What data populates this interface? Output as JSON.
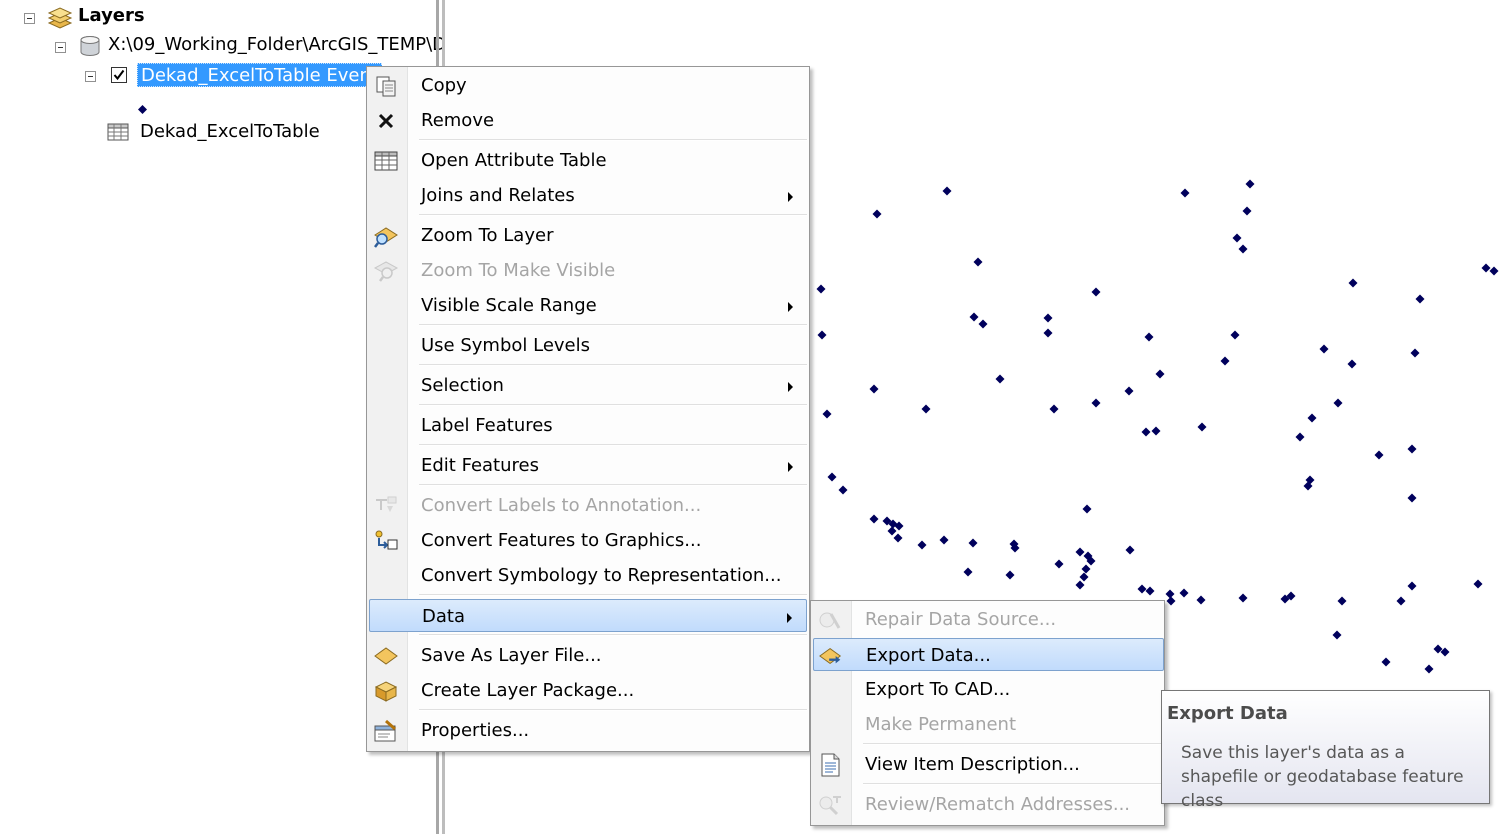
{
  "toc": {
    "root_label": "Layers",
    "data_source": "X:\\09_Working_Folder\\ArcGIS_TEMP\\D",
    "selected_layer": "Dekad_ExcelToTable Event",
    "table_name": "Dekad_ExcelToTable",
    "point_color": "#00005c"
  },
  "context_menu": {
    "items": [
      {
        "label": "Copy",
        "icon": "copy-icon",
        "enabled": true,
        "submenu": false
      },
      {
        "label": "Remove",
        "icon": "remove-x-icon",
        "enabled": true,
        "submenu": false
      },
      {
        "label": "Open Attribute Table",
        "icon": "attribute-table-icon",
        "enabled": true,
        "submenu": false
      },
      {
        "label": "Joins and Relates",
        "icon": "",
        "enabled": true,
        "submenu": true
      },
      {
        "label": "Zoom To Layer",
        "icon": "zoom-to-layer-icon",
        "enabled": true,
        "submenu": false
      },
      {
        "label": "Zoom To Make Visible",
        "icon": "zoom-to-make-visible-icon",
        "enabled": false,
        "submenu": false
      },
      {
        "label": "Visible Scale Range",
        "icon": "",
        "enabled": true,
        "submenu": true
      },
      {
        "label": "Use Symbol Levels",
        "icon": "",
        "enabled": true,
        "submenu": false
      },
      {
        "label": "Selection",
        "icon": "",
        "enabled": true,
        "submenu": true
      },
      {
        "label": "Label Features",
        "icon": "",
        "enabled": true,
        "submenu": false
      },
      {
        "label": "Edit Features",
        "icon": "",
        "enabled": true,
        "submenu": true
      },
      {
        "label": "Convert Labels to Annotation...",
        "icon": "convert-labels-icon",
        "enabled": false,
        "submenu": false
      },
      {
        "label": "Convert Features to Graphics...",
        "icon": "convert-features-icon",
        "enabled": true,
        "submenu": false
      },
      {
        "label": "Convert Symbology to Representation...",
        "icon": "",
        "enabled": true,
        "submenu": false
      },
      {
        "label": "Data",
        "icon": "",
        "enabled": true,
        "submenu": true,
        "highlighted": true
      },
      {
        "label": "Save As Layer File...",
        "icon": "layer-file-icon",
        "enabled": true,
        "submenu": false
      },
      {
        "label": "Create Layer Package...",
        "icon": "layer-package-icon",
        "enabled": true,
        "submenu": false
      },
      {
        "label": "Properties...",
        "icon": "properties-icon",
        "enabled": true,
        "submenu": false
      }
    ]
  },
  "data_submenu": {
    "items": [
      {
        "label": "Repair Data Source...",
        "icon": "repair-data-source-icon",
        "enabled": false
      },
      {
        "label": "Export Data...",
        "icon": "export-data-icon",
        "enabled": true,
        "highlighted": true
      },
      {
        "label": "Export To CAD...",
        "icon": "",
        "enabled": true
      },
      {
        "label": "Make Permanent",
        "icon": "",
        "enabled": false
      },
      {
        "label": "View Item Description...",
        "icon": "item-description-icon",
        "enabled": true
      },
      {
        "label": "Review/Rematch Addresses...",
        "icon": "rematch-addresses-icon",
        "enabled": false
      }
    ]
  },
  "tooltip": {
    "title": "Export Data",
    "body": "Save this layer's data as a shapefile or geodatabase feature class"
  }
}
